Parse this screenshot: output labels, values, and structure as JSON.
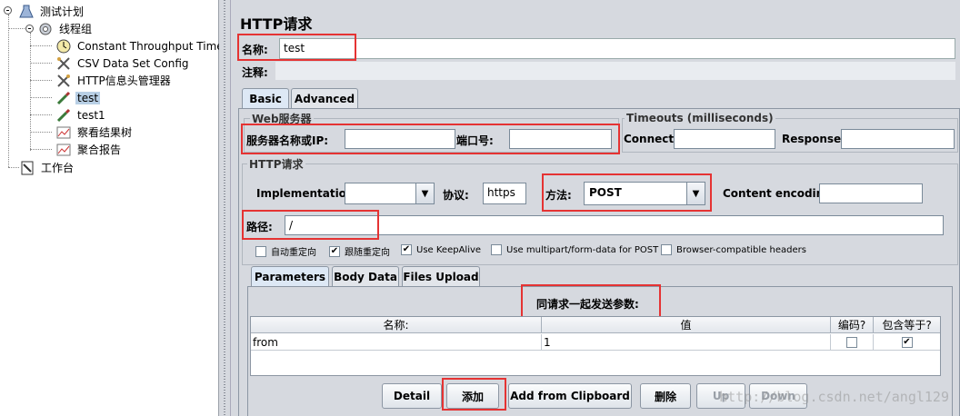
{
  "tree": {
    "items": [
      {
        "label": "测试计划",
        "icon": "test-plan-icon"
      },
      {
        "label": "线程组",
        "icon": "thread-group-gear-icon"
      },
      {
        "label": "Constant Throughput Timer",
        "icon": "timer-clock-icon"
      },
      {
        "label": "CSV Data Set Config",
        "icon": "config-wrench-icon"
      },
      {
        "label": "HTTP信息头管理器",
        "icon": "header-wrench-icon"
      },
      {
        "label": "test",
        "icon": "sampler-pipette-icon"
      },
      {
        "label": "test1",
        "icon": "sampler-pipette-icon"
      },
      {
        "label": "察看结果树",
        "icon": "listener-chart-icon"
      },
      {
        "label": "聚合报告",
        "icon": "listener-chart-icon"
      },
      {
        "label": "工作台",
        "icon": "workbench-icon"
      }
    ]
  },
  "panel": {
    "title": "HTTP请求",
    "name_label": "名称:",
    "name_value": "test",
    "comment_label": "注释:",
    "tabs": [
      "Basic",
      "Advanced"
    ],
    "web_server": {
      "group_title": "Web服务器",
      "server_label": "服务器名称或IP:",
      "server_value": "",
      "port_label": "端口号:",
      "port_value": ""
    },
    "timeouts": {
      "group_title": "Timeouts (milliseconds)",
      "connect_label": "Connect:",
      "response_label": "Response:"
    },
    "http_request": {
      "group_title": "HTTP请求",
      "implementation_label": "Implementation:",
      "implementation_value": "",
      "protocol_label": "协议:",
      "protocol_value": "https",
      "method_label": "方法:",
      "method_value": "POST",
      "encoding_label": "Content encoding:",
      "path_label": "路径:",
      "path_value": "/"
    },
    "checkboxes": [
      {
        "label": "自动重定向",
        "checked": false
      },
      {
        "label": "跟随重定向",
        "checked": true
      },
      {
        "label": "Use KeepAlive",
        "checked": true
      },
      {
        "label": "Use multipart/form-data for POST",
        "checked": false
      },
      {
        "label": "Browser-compatible headers",
        "checked": false
      }
    ],
    "sub_tabs": [
      "Parameters",
      "Body Data",
      "Files Upload"
    ],
    "params_caption": "同请求一起发送参数:",
    "table": {
      "headers": [
        "名称:",
        "值",
        "编码?",
        "包含等于?"
      ],
      "rows": [
        {
          "name": "from",
          "value": "1",
          "encode": false,
          "include_equals": true
        }
      ]
    },
    "buttons": [
      "Detail",
      "添加",
      "Add from Clipboard",
      "删除",
      "Up",
      "Down"
    ],
    "check_mark": "✔"
  },
  "watermark": "http://blog.csdn.net/angl129",
  "colors": {
    "highlight": "#e53333",
    "selection": "#b8cfe5",
    "background": "#d6d9df"
  }
}
